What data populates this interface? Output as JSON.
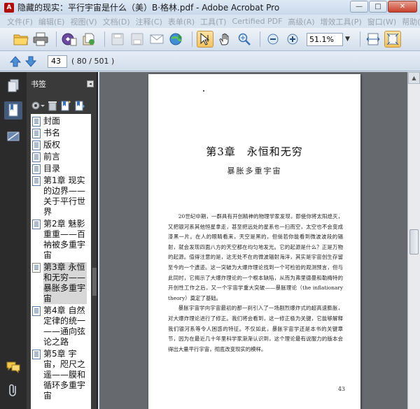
{
  "window": {
    "title": "隐藏的现实：平行宇宙是什么（美）B·格林.pdf - Adobe Acrobat Pro",
    "min_glyph": "—",
    "max_glyph": "□",
    "close_glyph": "✕"
  },
  "menu": [
    "文件(F)",
    "编辑(E)",
    "视图(V)",
    "文档(D)",
    "注释(C)",
    "表单(R)",
    "工具(T)",
    "Certified PDF",
    "高级(A)",
    "增效工具(P)",
    "窗口(W)",
    "帮助(H)"
  ],
  "toolbar": {
    "zoom_value": "51.1%",
    "zoom_arrow": "▼"
  },
  "nav": {
    "current_page": "43",
    "page_count": "( 80 / 501 )"
  },
  "bookmarks": {
    "title": "书签",
    "collapse_glyph": "◂",
    "items": [
      {
        "label": "封面"
      },
      {
        "label": "书名"
      },
      {
        "label": "版权"
      },
      {
        "label": "前言"
      },
      {
        "label": "目录"
      },
      {
        "label": "第1章 现实的边界——关于平行世界"
      },
      {
        "label": "第2章 魅影重重——百衲被多重宇宙"
      },
      {
        "label": "第3章 永恒和无穷——暴胀多重宇宙"
      },
      {
        "label": "第4章 自然定律的统一——通向弦论之路"
      },
      {
        "label": "第5章 宇宙，咫尺之遥——膜和循环多重宇宙"
      }
    ]
  },
  "document": {
    "chapter_title": "第3章　永恒和无穷",
    "chapter_subtitle": "暴胀多重宇宙",
    "paragraph_1": "20世纪中期，一群具有开创精神的物理学家发现，即使你将太阳熄灭，又把银河系其他恒星拿走，甚至把远处的星系也一扫而空，太空也不会变成漆黑一片。在人的眼睛看来，天空是黑的，但倘若你能看到微波波段的辐射，就会发现四面八方的天空都在均匀地发光。它的起源是什么？正是万物的起源。值得注意的是，这无处不在的微波辐射海洋，其实是宇宙创生存留至今的一个遗迹。这一突破为大爆炸理论找到一个可检验的观测预言，但与此同时，它揭示了大爆炸理论的一个根本缺陷，从而为弗里德曼和勒梅特的开创性工作之后，又一个宇宙学重大突破——暴胀理论（the inflationary theory）奠定了基础。",
    "paragraph_2": "暴胀宇宙学向宇宙最初的那一刹引入了一场剧烈爆炸式的超高速膨胀，对大爆炸理论进行了修正。我们将会看到，这一修正极为关键，它能够解释我们银河系等令人困惑的特征。不仅如此，暴胀宇宙学还是本书的关键章节，因为在最近几十年里科学家渐渐认识到，这个理论最有说服力的版本会得出大量平行宇宙，彻底改变现实的模样。",
    "page_number": "43"
  }
}
